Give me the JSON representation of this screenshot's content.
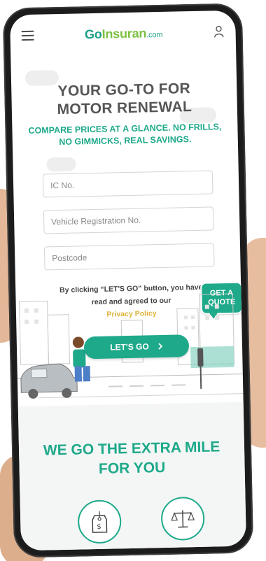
{
  "header": {
    "logo_go": "Go",
    "logo_ins": "Insuran",
    "logo_com": ".com",
    "menu_icon": "hamburger-menu-icon",
    "account_icon": "user-icon"
  },
  "hero": {
    "title_line1": "YOUR GO-TO FOR",
    "title_line2": "MOTOR RENEWAL",
    "subtitle_line1": "COMPARE PRICES AT A GLANCE. NO FRILLS,",
    "subtitle_line2": "NO GIMMICKS, REAL SAVINGS."
  },
  "form": {
    "ic_placeholder": "IC No.",
    "vehicle_placeholder": "Vehicle Registration No.",
    "postcode_placeholder": "Postcode",
    "notice_line1": "By clicking “LET'S GO” button, you have",
    "notice_line2": "read and agreed to our",
    "policy_link": "Privacy Policy",
    "submit_label": "LET'S GO",
    "submit_icon": "chevron-right-icon"
  },
  "badge": {
    "line1": "GET A",
    "line2": "QUOTE"
  },
  "section2": {
    "title_line1": "WE GO THE EXTRA MILE",
    "title_line2": "FOR YOU",
    "icons": [
      "price-tag-icon",
      "balance-scale-icon"
    ]
  },
  "colors": {
    "brand_teal": "#1ea98a",
    "brand_green": "#7cc041",
    "link_gold": "#e0b43a",
    "heading_gray": "#555555"
  }
}
